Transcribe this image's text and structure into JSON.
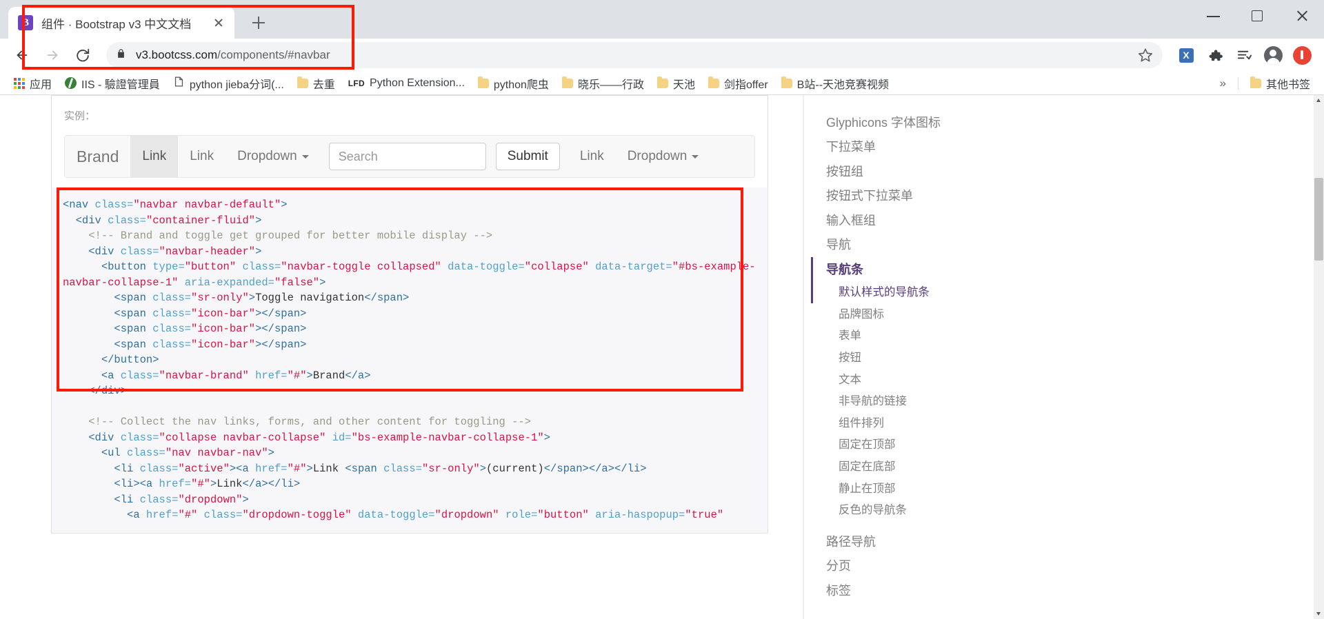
{
  "browser": {
    "tab": {
      "favicon": "bootstrap-b-icon",
      "favicon_letter": "B",
      "title": "组件 · Bootstrap v3 中文文档"
    },
    "new_tab_label": "+",
    "window_controls": {
      "minimize": "minimize-icon",
      "maximize": "maximize-icon",
      "close": "close-icon"
    },
    "toolbar": {
      "back": "back-arrow-icon",
      "forward": "forward-arrow-icon",
      "reload": "reload-icon",
      "lock": "lock-icon",
      "url_domain": "v3.bootcss.com",
      "url_path": "/components/#navbar",
      "url_full": "v3.bootcss.com/components/#navbar",
      "bookmark_star": "star-icon",
      "extension_letter": "X",
      "extensions_puzzle": "puzzle-piece-icon",
      "reading_list": "reading-list-icon",
      "profile": "profile-avatar-icon",
      "update": "update-available-icon"
    },
    "bookmarks": {
      "apps_label": "应用",
      "items": [
        {
          "icon": "globe-icon",
          "label": "IIS - 驗證管理員"
        },
        {
          "icon": "page-icon",
          "label": "python jieba分词(..."
        },
        {
          "icon": "folder-icon",
          "label": "去重"
        },
        {
          "icon": "lfd-icon",
          "label": "Python Extension..."
        },
        {
          "icon": "folder-icon",
          "label": "python爬虫"
        },
        {
          "icon": "folder-icon",
          "label": "晓乐——行政"
        },
        {
          "icon": "folder-icon",
          "label": "天池"
        },
        {
          "icon": "folder-icon",
          "label": "剑指offer"
        },
        {
          "icon": "folder-icon",
          "label": "B站--天池竞赛视频"
        }
      ],
      "overflow_label": "»",
      "other_bookmarks": {
        "icon": "folder-icon",
        "label": "其他书签"
      }
    }
  },
  "page": {
    "example_label": "实例：",
    "navbar_demo": {
      "brand": "Brand",
      "link1": "Link",
      "link2": "Link",
      "dropdown1": "Dropdown",
      "search_placeholder": "Search",
      "submit": "Submit",
      "link3": "Link",
      "dropdown2": "Dropdown",
      "caret": "caret-down-icon"
    },
    "code_lines": [
      {
        "indent": 0,
        "parts": [
          {
            "t": "tag",
            "v": "<nav "
          },
          {
            "t": "attr",
            "v": "class="
          },
          {
            "t": "str",
            "v": "\"navbar navbar-default\""
          },
          {
            "t": "tag",
            "v": ">"
          }
        ]
      },
      {
        "indent": 1,
        "parts": [
          {
            "t": "tag",
            "v": "<div "
          },
          {
            "t": "attr",
            "v": "class="
          },
          {
            "t": "str",
            "v": "\"container-fluid\""
          },
          {
            "t": "tag",
            "v": ">"
          }
        ]
      },
      {
        "indent": 2,
        "parts": [
          {
            "t": "cmt",
            "v": "<!-- Brand and toggle get grouped for better mobile display -->"
          }
        ]
      },
      {
        "indent": 2,
        "parts": [
          {
            "t": "tag",
            "v": "<div "
          },
          {
            "t": "attr",
            "v": "class="
          },
          {
            "t": "str",
            "v": "\"navbar-header\""
          },
          {
            "t": "tag",
            "v": ">"
          }
        ]
      },
      {
        "indent": 3,
        "parts": [
          {
            "t": "tag",
            "v": "<button "
          },
          {
            "t": "attr",
            "v": "type="
          },
          {
            "t": "str",
            "v": "\"button\""
          },
          {
            "t": "txt",
            "v": " "
          },
          {
            "t": "attr",
            "v": "class="
          },
          {
            "t": "str",
            "v": "\"navbar-toggle collapsed\""
          },
          {
            "t": "txt",
            "v": " "
          },
          {
            "t": "attr",
            "v": "data-toggle="
          },
          {
            "t": "str",
            "v": "\"collapse\""
          },
          {
            "t": "txt",
            "v": " "
          },
          {
            "t": "attr",
            "v": "data-target="
          },
          {
            "t": "str",
            "v": "\"#bs-example-navbar-collapse-1\""
          },
          {
            "t": "txt",
            "v": " "
          },
          {
            "t": "attr",
            "v": "aria-expanded="
          },
          {
            "t": "str",
            "v": "\"false\""
          },
          {
            "t": "tag",
            "v": ">"
          }
        ]
      },
      {
        "indent": 4,
        "parts": [
          {
            "t": "tag",
            "v": "<span "
          },
          {
            "t": "attr",
            "v": "class="
          },
          {
            "t": "str",
            "v": "\"sr-only\""
          },
          {
            "t": "tag",
            "v": ">"
          },
          {
            "t": "txt",
            "v": "Toggle navigation"
          },
          {
            "t": "tag",
            "v": "</span>"
          }
        ]
      },
      {
        "indent": 4,
        "parts": [
          {
            "t": "tag",
            "v": "<span "
          },
          {
            "t": "attr",
            "v": "class="
          },
          {
            "t": "str",
            "v": "\"icon-bar\""
          },
          {
            "t": "tag",
            "v": "></span>"
          }
        ]
      },
      {
        "indent": 4,
        "parts": [
          {
            "t": "tag",
            "v": "<span "
          },
          {
            "t": "attr",
            "v": "class="
          },
          {
            "t": "str",
            "v": "\"icon-bar\""
          },
          {
            "t": "tag",
            "v": "></span>"
          }
        ]
      },
      {
        "indent": 4,
        "parts": [
          {
            "t": "tag",
            "v": "<span "
          },
          {
            "t": "attr",
            "v": "class="
          },
          {
            "t": "str",
            "v": "\"icon-bar\""
          },
          {
            "t": "tag",
            "v": "></span>"
          }
        ]
      },
      {
        "indent": 3,
        "parts": [
          {
            "t": "tag",
            "v": "</button>"
          }
        ]
      },
      {
        "indent": 3,
        "parts": [
          {
            "t": "tag",
            "v": "<a "
          },
          {
            "t": "attr",
            "v": "class="
          },
          {
            "t": "str",
            "v": "\"navbar-brand\""
          },
          {
            "t": "txt",
            "v": " "
          },
          {
            "t": "attr",
            "v": "href="
          },
          {
            "t": "str",
            "v": "\"#\""
          },
          {
            "t": "tag",
            "v": ">"
          },
          {
            "t": "txt",
            "v": "Brand"
          },
          {
            "t": "tag",
            "v": "</a>"
          }
        ]
      },
      {
        "indent": 2,
        "parts": [
          {
            "t": "tag",
            "v": "</div>"
          }
        ]
      },
      {
        "indent": 0,
        "parts": [
          {
            "t": "txt",
            "v": ""
          }
        ]
      },
      {
        "indent": 2,
        "parts": [
          {
            "t": "cmt",
            "v": "<!-- Collect the nav links, forms, and other content for toggling -->"
          }
        ]
      },
      {
        "indent": 2,
        "parts": [
          {
            "t": "tag",
            "v": "<div "
          },
          {
            "t": "attr",
            "v": "class="
          },
          {
            "t": "str",
            "v": "\"collapse navbar-collapse\""
          },
          {
            "t": "txt",
            "v": " "
          },
          {
            "t": "attr",
            "v": "id="
          },
          {
            "t": "str",
            "v": "\"bs-example-navbar-collapse-1\""
          },
          {
            "t": "tag",
            "v": ">"
          }
        ]
      },
      {
        "indent": 3,
        "parts": [
          {
            "t": "tag",
            "v": "<ul "
          },
          {
            "t": "attr",
            "v": "class="
          },
          {
            "t": "str",
            "v": "\"nav navbar-nav\""
          },
          {
            "t": "tag",
            "v": ">"
          }
        ]
      },
      {
        "indent": 4,
        "parts": [
          {
            "t": "tag",
            "v": "<li "
          },
          {
            "t": "attr",
            "v": "class="
          },
          {
            "t": "str",
            "v": "\"active\""
          },
          {
            "t": "tag",
            "v": "><a "
          },
          {
            "t": "attr",
            "v": "href="
          },
          {
            "t": "str",
            "v": "\"#\""
          },
          {
            "t": "tag",
            "v": ">"
          },
          {
            "t": "txt",
            "v": "Link "
          },
          {
            "t": "tag",
            "v": "<span "
          },
          {
            "t": "attr",
            "v": "class="
          },
          {
            "t": "str",
            "v": "\"sr-only\""
          },
          {
            "t": "tag",
            "v": ">"
          },
          {
            "t": "txt",
            "v": "(current)"
          },
          {
            "t": "tag",
            "v": "</span></a></li>"
          }
        ]
      },
      {
        "indent": 4,
        "parts": [
          {
            "t": "tag",
            "v": "<li><a "
          },
          {
            "t": "attr",
            "v": "href="
          },
          {
            "t": "str",
            "v": "\"#\""
          },
          {
            "t": "tag",
            "v": ">"
          },
          {
            "t": "txt",
            "v": "Link"
          },
          {
            "t": "tag",
            "v": "</a></li>"
          }
        ]
      },
      {
        "indent": 4,
        "parts": [
          {
            "t": "tag",
            "v": "<li "
          },
          {
            "t": "attr",
            "v": "class="
          },
          {
            "t": "str",
            "v": "\"dropdown\""
          },
          {
            "t": "tag",
            "v": ">"
          }
        ]
      },
      {
        "indent": 5,
        "parts": [
          {
            "t": "tag",
            "v": "<a "
          },
          {
            "t": "attr",
            "v": "href="
          },
          {
            "t": "str",
            "v": "\"#\""
          },
          {
            "t": "txt",
            "v": " "
          },
          {
            "t": "attr",
            "v": "class="
          },
          {
            "t": "str",
            "v": "\"dropdown-toggle\""
          },
          {
            "t": "txt",
            "v": " "
          },
          {
            "t": "attr",
            "v": "data-toggle="
          },
          {
            "t": "str",
            "v": "\"dropdown\""
          },
          {
            "t": "txt",
            "v": " "
          },
          {
            "t": "attr",
            "v": "role="
          },
          {
            "t": "str",
            "v": "\"button\""
          },
          {
            "t": "txt",
            "v": " "
          },
          {
            "t": "attr",
            "v": "aria-haspopup="
          },
          {
            "t": "str",
            "v": "\"true\""
          }
        ]
      }
    ],
    "sidebar": {
      "items": [
        {
          "label": "Glyphicons 字体图标",
          "level": 1,
          "active": false
        },
        {
          "label": "下拉菜单",
          "level": 1,
          "active": false
        },
        {
          "label": "按钮组",
          "level": 1,
          "active": false
        },
        {
          "label": "按钮式下拉菜单",
          "level": 1,
          "active": false
        },
        {
          "label": "输入框组",
          "level": 1,
          "active": false
        },
        {
          "label": "导航",
          "level": 1,
          "active": false
        },
        {
          "label": "导航条",
          "level": 1,
          "active": true
        },
        {
          "label": "默认样式的导航条",
          "level": 2,
          "active": true
        },
        {
          "label": "品牌图标",
          "level": 2,
          "active": false
        },
        {
          "label": "表单",
          "level": 2,
          "active": false
        },
        {
          "label": "按钮",
          "level": 2,
          "active": false
        },
        {
          "label": "文本",
          "level": 2,
          "active": false
        },
        {
          "label": "非导航的链接",
          "level": 2,
          "active": false
        },
        {
          "label": "组件排列",
          "level": 2,
          "active": false
        },
        {
          "label": "固定在顶部",
          "level": 2,
          "active": false
        },
        {
          "label": "固定在底部",
          "level": 2,
          "active": false
        },
        {
          "label": "静止在顶部",
          "level": 2,
          "active": false
        },
        {
          "label": "反色的导航条",
          "level": 2,
          "active": false
        },
        {
          "label": "路径导航",
          "level": 1,
          "active": false
        },
        {
          "label": "分页",
          "level": 1,
          "active": false
        },
        {
          "label": "标签",
          "level": 1,
          "active": false
        }
      ]
    }
  }
}
